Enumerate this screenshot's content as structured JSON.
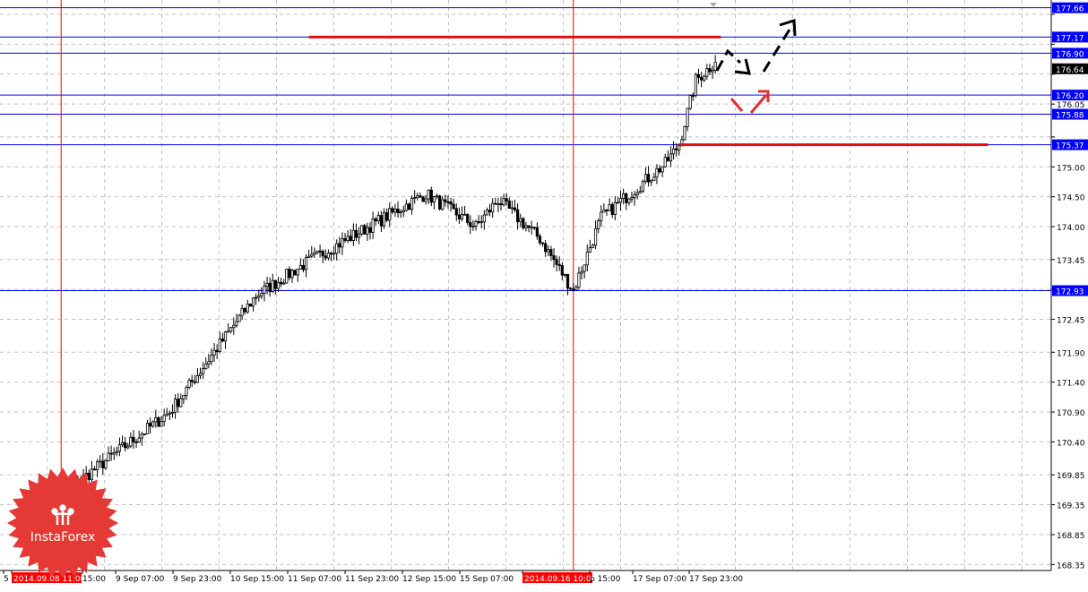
{
  "chart_data": {
    "type": "candlestick",
    "title": "",
    "xlabel": "",
    "ylabel": "",
    "ylim": [
      168.25,
      177.79
    ],
    "y_ticks": [
      168.35,
      168.85,
      169.35,
      169.85,
      170.4,
      170.9,
      171.4,
      171.9,
      172.45,
      172.95,
      173.45,
      174.0,
      174.5,
      175.0,
      175.5,
      176.05,
      176.55,
      177.05,
      177.55
    ],
    "x_tick_labels": [
      "5",
      "2014.09.08 11:00",
      "15:00",
      "9 Sep 07:00",
      "9 Sep 23:00",
      "10 Sep 15:00",
      "11 Sep 07:00",
      "11 Sep 23:00",
      "12 Sep 15:00",
      "15 Sep 07:00",
      "2014.09.16 10:00",
      "p 15:00",
      "17 Sep 07:00",
      "17 Sep 23:00"
    ],
    "horizontal_levels": [
      {
        "label": "177.66",
        "value": 177.66
      },
      {
        "label": "177.17",
        "value": 177.17
      },
      {
        "label": "176.90",
        "value": 176.9
      },
      {
        "label": "176.20",
        "value": 176.2
      },
      {
        "label": "175.88",
        "value": 175.88
      },
      {
        "label": "175.37",
        "value": 175.37
      },
      {
        "label": "172.93",
        "value": 172.93
      }
    ],
    "current_price": {
      "label": "176.64",
      "value": 176.64
    },
    "vertical_markers": [
      {
        "label": "2014.09.08 11:00",
        "bar": 21
      },
      {
        "label": "2014.09.16 10:00",
        "bar": 205
      }
    ],
    "target_lines": [
      {
        "value": 177.17,
        "from_bar": 110,
        "to_bar": 258
      },
      {
        "value": 175.37,
        "from_bar": 243,
        "to_bar": 354
      }
    ],
    "anchor_lows": [
      {
        "bar": 14,
        "value": 169.5
      },
      {
        "bar": 22,
        "value": 169.55
      },
      {
        "bar": 60,
        "value": 170.9
      },
      {
        "bar": 91,
        "value": 172.85
      },
      {
        "bar": 111,
        "value": 173.45
      },
      {
        "bar": 152,
        "value": 174.55
      },
      {
        "bar": 170,
        "value": 174.0
      },
      {
        "bar": 178,
        "value": 174.45
      },
      {
        "bar": 193,
        "value": 173.8
      },
      {
        "bar": 205,
        "value": 172.93
      },
      {
        "bar": 215,
        "value": 174.15
      },
      {
        "bar": 238,
        "value": 175.05
      },
      {
        "bar": 243,
        "value": 175.37
      },
      {
        "bar": 249,
        "value": 176.45
      },
      {
        "bar": 256,
        "value": 176.75
      }
    ],
    "series_seed": 7,
    "accent_colors": {
      "level": "#0000ff",
      "marker": "#ff0000",
      "target": "#e01010",
      "arrow_up": "#e03030",
      "arrow_black": "#000000",
      "grid": "#c0c0c0",
      "logo": "#e53935"
    },
    "logo_text": "InstaForex"
  }
}
